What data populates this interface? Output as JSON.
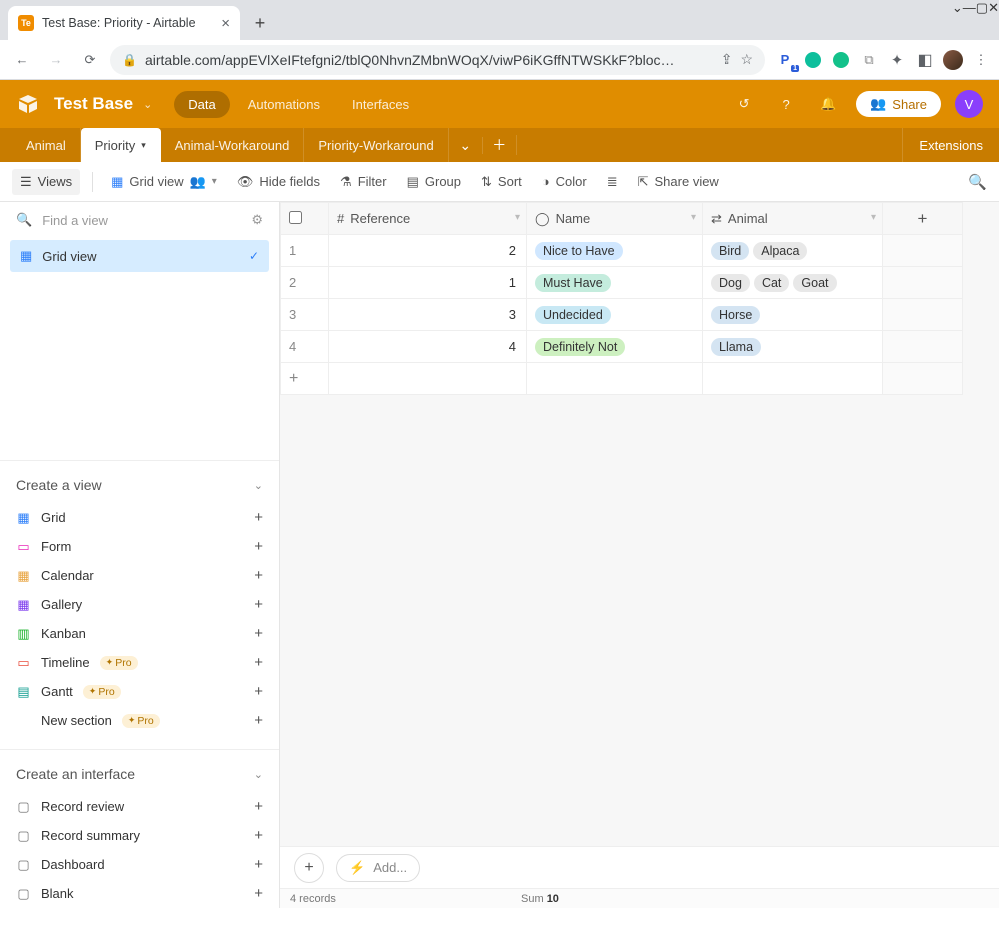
{
  "window": {
    "title": "Test Base: Priority - Airtable"
  },
  "browser": {
    "url": "airtable.com/appEVlXeIFtefgni2/tblQ0NhvnZMbnWOqX/viwP6iKGffNTWSKkF?bloc…",
    "ext_badge": "1"
  },
  "header": {
    "base_name": "Test Base",
    "nav": {
      "data": "Data",
      "automations": "Automations",
      "interfaces": "Interfaces"
    },
    "share": "Share",
    "avatar_initial": "V"
  },
  "tables": {
    "tabs": [
      "Animal",
      "Priority",
      "Animal-Workaround",
      "Priority-Workaround"
    ],
    "active_index": 1,
    "extensions": "Extensions"
  },
  "viewbar": {
    "views": "Views",
    "grid_view": "Grid view",
    "hide_fields": "Hide fields",
    "filter": "Filter",
    "group": "Group",
    "sort": "Sort",
    "color": "Color",
    "share_view": "Share view"
  },
  "sidebar": {
    "find_placeholder": "Find a view",
    "current_view": "Grid view",
    "create_view": "Create a view",
    "view_types": [
      {
        "label": "Grid",
        "icon": "grid",
        "pro": false
      },
      {
        "label": "Form",
        "icon": "form",
        "pro": false
      },
      {
        "label": "Calendar",
        "icon": "cal",
        "pro": false
      },
      {
        "label": "Gallery",
        "icon": "gallery",
        "pro": false
      },
      {
        "label": "Kanban",
        "icon": "kanban",
        "pro": false
      },
      {
        "label": "Timeline",
        "icon": "timeline",
        "pro": true
      },
      {
        "label": "Gantt",
        "icon": "gantt",
        "pro": true
      }
    ],
    "new_section": "New section",
    "pro": "Pro",
    "create_interface": "Create an interface",
    "interface_types": [
      "Record review",
      "Record summary",
      "Dashboard",
      "Blank"
    ]
  },
  "grid": {
    "columns": [
      "Reference",
      "Name",
      "Animal"
    ],
    "rows": [
      {
        "n": 1,
        "reference": "2",
        "name": "Nice to Have",
        "name_color": "blue",
        "animals": [
          {
            "t": "Bird",
            "c": "bluegray"
          },
          {
            "t": "Alpaca",
            "c": "gray"
          }
        ]
      },
      {
        "n": 2,
        "reference": "1",
        "name": "Must Have",
        "name_color": "teal",
        "animals": [
          {
            "t": "Dog",
            "c": "gray"
          },
          {
            "t": "Cat",
            "c": "gray"
          },
          {
            "t": "Goat",
            "c": "gray"
          }
        ]
      },
      {
        "n": 3,
        "reference": "3",
        "name": "Undecided",
        "name_color": "cyan",
        "animals": [
          {
            "t": "Horse",
            "c": "bluegray"
          }
        ]
      },
      {
        "n": 4,
        "reference": "4",
        "name": "Definitely Not",
        "name_color": "green",
        "animals": [
          {
            "t": "Llama",
            "c": "bluegray"
          }
        ]
      }
    ],
    "add_label": "Add...",
    "record_count": "4 records",
    "sum_label": "Sum",
    "sum_value": "10"
  }
}
